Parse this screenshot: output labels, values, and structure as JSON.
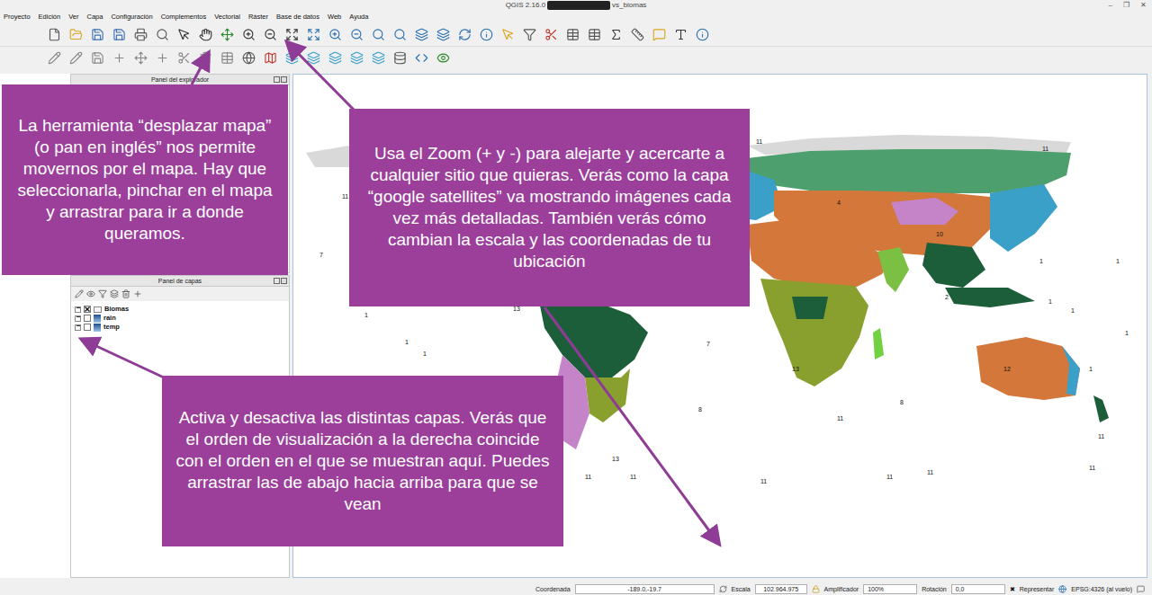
{
  "window": {
    "title_start": "QGIS 2.16.0",
    "title_end": "vs_biomas",
    "controls": [
      "–",
      "❐",
      "✕"
    ]
  },
  "menu": [
    "Proyecto",
    "Edición",
    "Ver",
    "Capa",
    "Configuración",
    "Complementos",
    "Vectorial",
    "Ráster",
    "Base de datos",
    "Web",
    "Ayuda"
  ],
  "panels": {
    "explorer": {
      "title": "Panel del explorador"
    },
    "layers": {
      "title": "Panel de capas",
      "items": [
        {
          "name": "Biomas",
          "checked": true,
          "expanded": false,
          "kind": "vector"
        },
        {
          "name": "rain",
          "checked": false,
          "expanded": false,
          "kind": "raster"
        },
        {
          "name": "temp",
          "checked": false,
          "expanded": false,
          "kind": "raster"
        }
      ]
    }
  },
  "map": {
    "labels": [
      "11",
      "11",
      "11",
      "11",
      "7",
      "7",
      "1",
      "1",
      "1",
      "1",
      "13",
      "13",
      "13",
      "4",
      "10",
      "12",
      "2",
      "1",
      "1",
      "1",
      "1",
      "1",
      "8",
      "8",
      "11",
      "11",
      "11",
      "11",
      "11",
      "11",
      "11",
      "11"
    ]
  },
  "status_bar": {
    "coordinate_label": "Coordenada",
    "coordinate": "-189.0,-19.7",
    "scale_label": "Escala",
    "scale": "102.964.975",
    "magnifier_label": "Amplificador",
    "magnifier": "100%",
    "rotation_label": "Rotación",
    "rotation": "0,0",
    "render": {
      "label": "Representar",
      "checked": true,
      "mark": "✖"
    },
    "crs": "EPSG:4326 (al vuelo)"
  },
  "callouts": [
    {
      "text": "La herramienta “desplazar mapa” (o pan en inglés” nos permite movernos por el mapa. Hay que seleccionarla, pinchar en el mapa y arrastrar para ir a donde queramos."
    },
    {
      "text": "Usa el Zoom (+ y -) para alejarte y acercarte a cualquier sitio que quieras. Verás como la capa “google satellites” va mostrando imágenes cada vez más detalladas. También verás cómo cambian la escala y las coordenadas de tu ubicación"
    },
    {
      "text": "Activa y desactiva las distintas capas. Verás que el orden de visualización a la derecha coincide con el orden en el que se muestran aquí. Puedes arrastrar las de abajo hacia arriba para que se vean"
    }
  ]
}
